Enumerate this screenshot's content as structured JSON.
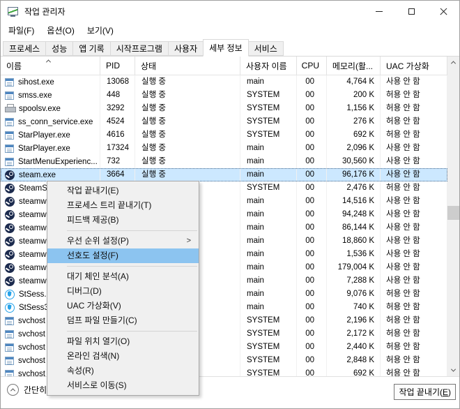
{
  "window": {
    "title": "작업 관리자"
  },
  "menubar": {
    "items": [
      {
        "id": "file",
        "label": "파일(F)"
      },
      {
        "id": "options",
        "label": "옵션(O)"
      },
      {
        "id": "view",
        "label": "보기(V)"
      }
    ]
  },
  "tabs": [
    {
      "id": "processes",
      "label": "프로세스",
      "active": false
    },
    {
      "id": "performance",
      "label": "성능",
      "active": false
    },
    {
      "id": "app-history",
      "label": "앱 기록",
      "active": false
    },
    {
      "id": "startup",
      "label": "시작프로그램",
      "active": false
    },
    {
      "id": "users",
      "label": "사용자",
      "active": false
    },
    {
      "id": "details",
      "label": "세부 정보",
      "active": true
    },
    {
      "id": "services",
      "label": "서비스",
      "active": false
    }
  ],
  "table": {
    "columns": [
      {
        "id": "name",
        "label": "이름",
        "sorted": "asc"
      },
      {
        "id": "pid",
        "label": "PID"
      },
      {
        "id": "status",
        "label": "상태"
      },
      {
        "id": "user",
        "label": "사용자 이름"
      },
      {
        "id": "cpu",
        "label": "CPU",
        "align": "right"
      },
      {
        "id": "mem",
        "label": "메모리(활...",
        "align": "right"
      },
      {
        "id": "uac",
        "label": "UAC 가상화"
      }
    ],
    "rows": [
      {
        "icon": "app",
        "name": "sihost.exe",
        "pid": "13068",
        "status": "실행 중",
        "user": "main",
        "cpu": "00",
        "mem": "4,764 K",
        "uac": "사용 안 함",
        "selected": false
      },
      {
        "icon": "app",
        "name": "smss.exe",
        "pid": "448",
        "status": "실행 중",
        "user": "SYSTEM",
        "cpu": "00",
        "mem": "200 K",
        "uac": "허용 안 함",
        "selected": false
      },
      {
        "icon": "printer",
        "name": "spoolsv.exe",
        "pid": "3292",
        "status": "실행 중",
        "user": "SYSTEM",
        "cpu": "00",
        "mem": "1,156 K",
        "uac": "허용 안 함",
        "selected": false
      },
      {
        "icon": "app",
        "name": "ss_conn_service.exe",
        "pid": "4524",
        "status": "실행 중",
        "user": "SYSTEM",
        "cpu": "00",
        "mem": "276 K",
        "uac": "허용 안 함",
        "selected": false
      },
      {
        "icon": "app",
        "name": "StarPlayer.exe",
        "pid": "4616",
        "status": "실행 중",
        "user": "SYSTEM",
        "cpu": "00",
        "mem": "692 K",
        "uac": "허용 안 함",
        "selected": false
      },
      {
        "icon": "app",
        "name": "StarPlayer.exe",
        "pid": "17324",
        "status": "실행 중",
        "user": "main",
        "cpu": "00",
        "mem": "2,096 K",
        "uac": "사용 안 함",
        "selected": false
      },
      {
        "icon": "app",
        "name": "StartMenuExperienc...",
        "pid": "732",
        "status": "실행 중",
        "user": "main",
        "cpu": "00",
        "mem": "30,560 K",
        "uac": "사용 안 함",
        "selected": false
      },
      {
        "icon": "steam",
        "name": "steam.exe",
        "pid": "3664",
        "status": "실행 중",
        "user": "main",
        "cpu": "00",
        "mem": "96,176 K",
        "uac": "사용 안 함",
        "selected": true
      },
      {
        "icon": "steam",
        "name": "SteamS",
        "pid": "",
        "status": "",
        "user": "SYSTEM",
        "cpu": "00",
        "mem": "2,476 K",
        "uac": "허용 안 함",
        "selected": false
      },
      {
        "icon": "steam",
        "name": "steamw",
        "pid": "",
        "status": "",
        "user": "main",
        "cpu": "00",
        "mem": "14,516 K",
        "uac": "사용 안 함",
        "selected": false
      },
      {
        "icon": "steam",
        "name": "steamw",
        "pid": "",
        "status": "",
        "user": "main",
        "cpu": "00",
        "mem": "94,248 K",
        "uac": "사용 안 함",
        "selected": false
      },
      {
        "icon": "steam",
        "name": "steamw",
        "pid": "",
        "status": "",
        "user": "main",
        "cpu": "00",
        "mem": "86,144 K",
        "uac": "사용 안 함",
        "selected": false
      },
      {
        "icon": "steam",
        "name": "steamw",
        "pid": "",
        "status": "",
        "user": "main",
        "cpu": "00",
        "mem": "18,860 K",
        "uac": "사용 안 함",
        "selected": false
      },
      {
        "icon": "steam",
        "name": "steamw",
        "pid": "",
        "status": "",
        "user": "main",
        "cpu": "00",
        "mem": "1,536 K",
        "uac": "사용 안 함",
        "selected": false
      },
      {
        "icon": "steam",
        "name": "steamw",
        "pid": "",
        "status": "",
        "user": "main",
        "cpu": "00",
        "mem": "179,004 K",
        "uac": "사용 안 함",
        "selected": false
      },
      {
        "icon": "steam",
        "name": "steamw",
        "pid": "",
        "status": "",
        "user": "main",
        "cpu": "00",
        "mem": "7,288 K",
        "uac": "사용 안 함",
        "selected": false
      },
      {
        "icon": "shield",
        "name": "StSess.",
        "pid": "",
        "status": "",
        "user": "main",
        "cpu": "00",
        "mem": "9,076 K",
        "uac": "허용 안 함",
        "selected": false
      },
      {
        "icon": "shield",
        "name": "StSess3",
        "pid": "",
        "status": "",
        "user": "main",
        "cpu": "00",
        "mem": "740 K",
        "uac": "허용 안 함",
        "selected": false
      },
      {
        "icon": "app",
        "name": "svchost",
        "pid": "",
        "status": "",
        "user": "SYSTEM",
        "cpu": "00",
        "mem": "2,196 K",
        "uac": "허용 안 함",
        "selected": false
      },
      {
        "icon": "app",
        "name": "svchost",
        "pid": "",
        "status": "",
        "user": "SYSTEM",
        "cpu": "00",
        "mem": "2,172 K",
        "uac": "허용 안 함",
        "selected": false
      },
      {
        "icon": "app",
        "name": "svchost",
        "pid": "",
        "status": "",
        "user": "SYSTEM",
        "cpu": "00",
        "mem": "2,440 K",
        "uac": "허용 안 함",
        "selected": false
      },
      {
        "icon": "app",
        "name": "svchost",
        "pid": "",
        "status": "",
        "user": "SYSTEM",
        "cpu": "00",
        "mem": "2,848 K",
        "uac": "허용 안 함",
        "selected": false
      },
      {
        "icon": "app",
        "name": "svchost",
        "pid": "",
        "status": "",
        "user": "SYSTEM",
        "cpu": "00",
        "mem": "692 K",
        "uac": "허용 안 함",
        "selected": false
      }
    ]
  },
  "context_menu": {
    "items": [
      {
        "id": "end-task",
        "label": "작업 끝내기(E)"
      },
      {
        "id": "end-process-tree",
        "label": "프로세스 트리 끝내기(T)"
      },
      {
        "id": "provide-feedback",
        "label": "피드백 제공(B)"
      },
      {
        "type": "separator"
      },
      {
        "id": "set-priority",
        "label": "우선 순위 설정(P)",
        "submenu": true
      },
      {
        "id": "set-affinity",
        "label": "선호도 설정(F)",
        "highlighted": true
      },
      {
        "type": "separator"
      },
      {
        "id": "analyze-wait-chain",
        "label": "대기 체인 분석(A)"
      },
      {
        "id": "debug",
        "label": "디버그(D)"
      },
      {
        "id": "uac-virtualization",
        "label": "UAC 가상화(V)"
      },
      {
        "id": "create-dump-file",
        "label": "덤프 파일 만들기(C)"
      },
      {
        "type": "separator"
      },
      {
        "id": "open-file-location",
        "label": "파일 위치 열기(O)"
      },
      {
        "id": "search-online",
        "label": "온라인 검색(N)"
      },
      {
        "id": "properties",
        "label": "속성(R)"
      },
      {
        "id": "go-to-services",
        "label": "서비스로 이동(S)"
      }
    ]
  },
  "footer": {
    "simple_view": {
      "label": "간단히(D)"
    },
    "end_task": {
      "pre": "작업 끝내기(",
      "key": "E",
      "post": ")"
    }
  },
  "colors": {
    "selection_bg": "#cce8ff",
    "menu_highlight": "#8cc4f0",
    "menu_bg": "#f0f0f0"
  }
}
